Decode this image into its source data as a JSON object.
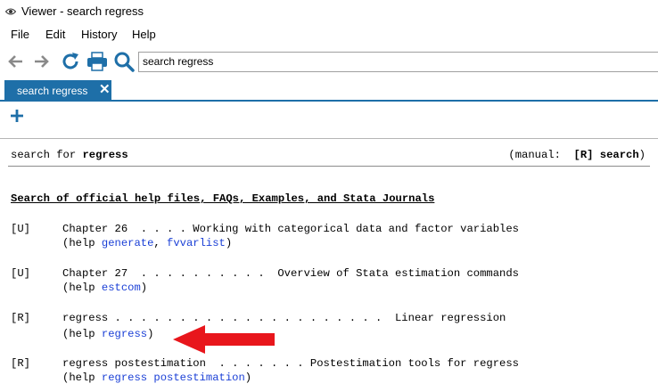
{
  "window": {
    "title": "Viewer - search regress"
  },
  "menu": [
    "File",
    "Edit",
    "History",
    "Help"
  ],
  "toolbar": {
    "search_value": "search regress"
  },
  "tab": {
    "label": "search regress",
    "close": "✕"
  },
  "header": {
    "prefix": "search for ",
    "term": "regress",
    "manual_prefix": "(manual:  ",
    "manual_ref": "[R] search",
    "manual_suffix": ")"
  },
  "section_heading": "Search of official help files, FAQs, Examples, and Stata Journals",
  "entries": [
    {
      "tag": "[U]",
      "line": "Chapter 26  . . . . Working with categorical data and factor variables",
      "help_prefix": "(help ",
      "links": [
        "generate",
        "fvvarlist"
      ],
      "separator": ", ",
      "help_suffix": ")"
    },
    {
      "tag": "[U]",
      "line": "Chapter 27  . . . . . . . . . .  Overview of Stata estimation commands",
      "help_prefix": "(help ",
      "links": [
        "estcom"
      ],
      "help_suffix": ")"
    },
    {
      "tag": "[R]",
      "line": "regress . . . . . . . . . . . . . . . . . . . . .  Linear regression",
      "help_prefix": "(help ",
      "links": [
        "regress"
      ],
      "help_suffix": ")"
    },
    {
      "tag": "[R]",
      "line": "regress postestimation  . . . . . . . Postestimation tools for regress",
      "help_prefix": "(help ",
      "links": [
        "regress postestimation"
      ],
      "help_suffix": ")"
    }
  ],
  "colors": {
    "accent": "#1e6fa8",
    "link": "#1a3fd6",
    "arrow": "#e8161c"
  },
  "icons": [
    "eye-icon",
    "back-arrow-icon",
    "forward-arrow-icon",
    "refresh-icon",
    "print-icon",
    "search-icon",
    "close-icon",
    "plus-icon",
    "red-arrow-annotation"
  ]
}
